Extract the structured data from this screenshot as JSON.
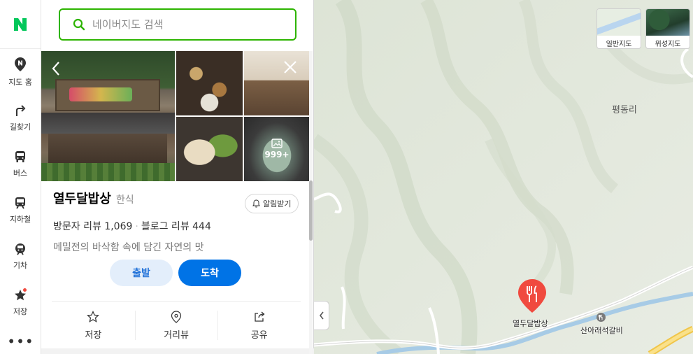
{
  "brand": {
    "logo_text": "N",
    "color": "#03c75a"
  },
  "nav": {
    "items": [
      {
        "label": "지도 홈",
        "icon": "map-pin-n-icon"
      },
      {
        "label": "길찾기",
        "icon": "direction-arrow-icon"
      },
      {
        "label": "버스",
        "icon": "bus-icon"
      },
      {
        "label": "지하철",
        "icon": "subway-icon"
      },
      {
        "label": "기차",
        "icon": "train-icon"
      },
      {
        "label": "저장",
        "icon": "star-icon"
      }
    ],
    "more": "•••"
  },
  "search": {
    "placeholder": "네이버지도 검색",
    "value": ""
  },
  "place": {
    "name": "열두달밥상",
    "category": "한식",
    "alarm_label": "알림받기",
    "visitor_reviews": "방문자 리뷰 1,069",
    "blog_reviews": "블로그 리뷰 444",
    "description": "메밀전의 바삭함 속에 담긴 자연의 맛",
    "photo_count": "999+"
  },
  "buttons": {
    "start": "출발",
    "arrive": "도착"
  },
  "actions": [
    {
      "label": "저장",
      "icon": "star-outline-icon"
    },
    {
      "label": "거리뷰",
      "icon": "location-pin-icon"
    },
    {
      "label": "공유",
      "icon": "share-icon"
    }
  ],
  "map": {
    "type_buttons": {
      "normal": "일반지도",
      "satellite": "위성지도"
    },
    "area_label": "평동리",
    "pin_label": "열두달밥상",
    "poi_label": "산아래석갈비"
  },
  "colors": {
    "accent": "#2db400",
    "primary_blue": "#0073e6",
    "pin_red": "#f04a3f",
    "river": "#a7cbe6"
  }
}
